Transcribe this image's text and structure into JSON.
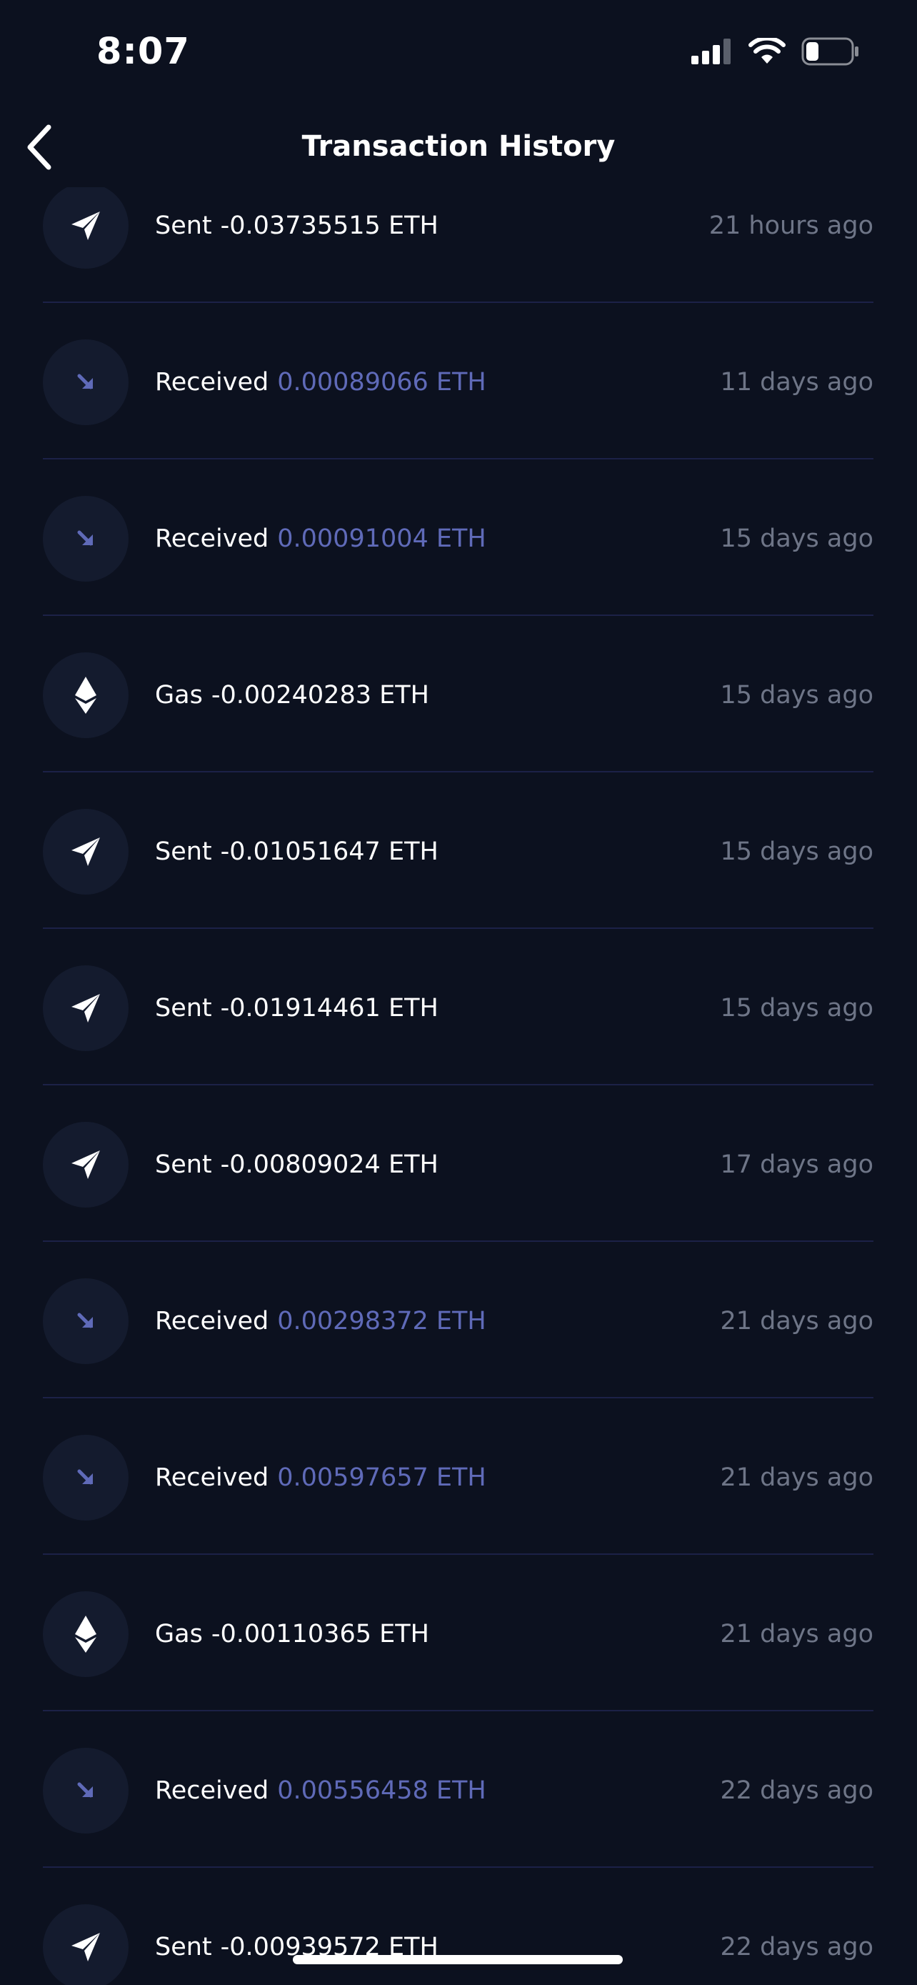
{
  "status_bar": {
    "time": "8:07"
  },
  "header": {
    "title": "Transaction History"
  },
  "colors": {
    "background": "#0c111f",
    "icon_circle": "#141b2e",
    "received_accent": "#5f6ab8",
    "divider": "#1c2147",
    "muted_text": "#6e7587"
  },
  "transactions": [
    {
      "type": "Sent",
      "amount": "-0.03735515 ETH",
      "time": "21 hours ago",
      "icon": "send-icon"
    },
    {
      "type": "Received",
      "amount": "0.00089066 ETH",
      "time": "11 days ago",
      "icon": "receive-arrow-icon"
    },
    {
      "type": "Received",
      "amount": "0.00091004 ETH",
      "time": "15 days ago",
      "icon": "receive-arrow-icon"
    },
    {
      "type": "Gas",
      "amount": "-0.00240283 ETH",
      "time": "15 days ago",
      "icon": "ethereum-icon"
    },
    {
      "type": "Sent",
      "amount": "-0.01051647 ETH",
      "time": "15 days ago",
      "icon": "send-icon"
    },
    {
      "type": "Sent",
      "amount": "-0.01914461 ETH",
      "time": "15 days ago",
      "icon": "send-icon"
    },
    {
      "type": "Sent",
      "amount": "-0.00809024 ETH",
      "time": "17 days ago",
      "icon": "send-icon"
    },
    {
      "type": "Received",
      "amount": "0.00298372 ETH",
      "time": "21 days ago",
      "icon": "receive-arrow-icon"
    },
    {
      "type": "Received",
      "amount": "0.00597657 ETH",
      "time": "21 days ago",
      "icon": "receive-arrow-icon"
    },
    {
      "type": "Gas",
      "amount": "-0.00110365 ETH",
      "time": "21 days ago",
      "icon": "ethereum-icon"
    },
    {
      "type": "Received",
      "amount": "0.00556458 ETH",
      "time": "22 days ago",
      "icon": "receive-arrow-icon"
    },
    {
      "type": "Sent",
      "amount": "-0.00939572 ETH",
      "time": "22 days ago",
      "icon": "send-icon"
    }
  ]
}
